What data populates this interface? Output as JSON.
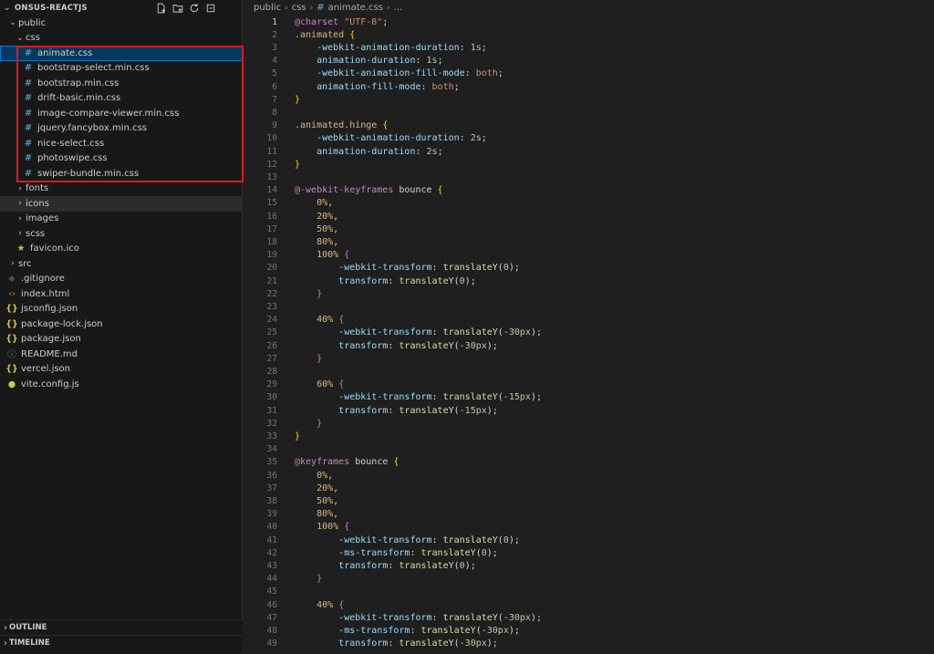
{
  "explorer": {
    "title": "ONSUS-REACTJS",
    "actions": [
      "new-file-icon",
      "new-folder-icon",
      "refresh-icon",
      "collapse-all-icon"
    ],
    "tree": [
      {
        "label": "public",
        "depth": 0,
        "kind": "folder",
        "open": true
      },
      {
        "label": "css",
        "depth": 1,
        "kind": "folder",
        "open": true
      },
      {
        "label": "animate.css",
        "depth": 2,
        "kind": "css",
        "selected": true
      },
      {
        "label": "bootstrap-select.min.css",
        "depth": 2,
        "kind": "css"
      },
      {
        "label": "bootstrap.min.css",
        "depth": 2,
        "kind": "css"
      },
      {
        "label": "drift-basic.min.css",
        "depth": 2,
        "kind": "css"
      },
      {
        "label": "image-compare-viewer.min.css",
        "depth": 2,
        "kind": "css"
      },
      {
        "label": "jquery.fancybox.min.css",
        "depth": 2,
        "kind": "css"
      },
      {
        "label": "nice-select.css",
        "depth": 2,
        "kind": "css"
      },
      {
        "label": "photoswipe.css",
        "depth": 2,
        "kind": "css"
      },
      {
        "label": "swiper-bundle.min.css",
        "depth": 2,
        "kind": "css"
      },
      {
        "label": "fonts",
        "depth": 1,
        "kind": "folder",
        "open": false
      },
      {
        "label": "icons",
        "depth": 1,
        "kind": "folder",
        "open": false,
        "hover": true
      },
      {
        "label": "images",
        "depth": 1,
        "kind": "folder",
        "open": false
      },
      {
        "label": "scss",
        "depth": 1,
        "kind": "folder",
        "open": false
      },
      {
        "label": "favicon.ico",
        "depth": 1,
        "kind": "ico"
      },
      {
        "label": "src",
        "depth": 0,
        "kind": "folder",
        "open": false
      },
      {
        "label": ".gitignore",
        "depth": 0,
        "kind": "git"
      },
      {
        "label": "index.html",
        "depth": 0,
        "kind": "html"
      },
      {
        "label": "jsconfig.json",
        "depth": 0,
        "kind": "json"
      },
      {
        "label": "package-lock.json",
        "depth": 0,
        "kind": "json"
      },
      {
        "label": "package.json",
        "depth": 0,
        "kind": "json"
      },
      {
        "label": "README.md",
        "depth": 0,
        "kind": "md"
      },
      {
        "label": "vercel.json",
        "depth": 0,
        "kind": "json"
      },
      {
        "label": "vite.config.js",
        "depth": 0,
        "kind": "js"
      }
    ],
    "outline_label": "OUTLINE",
    "timeline_label": "TIMELINE"
  },
  "breadcrumb": {
    "parts": [
      "public",
      "css"
    ],
    "file": "animate.css",
    "tail": "..."
  },
  "colors": {
    "accent": "#0078d4",
    "selection": "#04395e",
    "highlight_box": "#e3161e"
  },
  "editor": {
    "current_line": 1,
    "lines": [
      [
        [
          "t-at",
          "@charset "
        ],
        [
          "t-str",
          "\"UTF-8\""
        ],
        [
          "t-plain",
          ";"
        ]
      ],
      [
        [
          "t-sel",
          ".animated "
        ],
        [
          "t-b1",
          "{"
        ]
      ],
      [
        [
          "t-plain",
          "    "
        ],
        [
          "t-prop",
          "-webkit-animation-duration"
        ],
        [
          "t-plain",
          ": "
        ],
        [
          "t-num",
          "1s"
        ],
        [
          "t-plain",
          ";"
        ]
      ],
      [
        [
          "t-plain",
          "    "
        ],
        [
          "t-prop",
          "animation-duration"
        ],
        [
          "t-plain",
          ": "
        ],
        [
          "t-num",
          "1s"
        ],
        [
          "t-plain",
          ";"
        ]
      ],
      [
        [
          "t-plain",
          "    "
        ],
        [
          "t-prop",
          "-webkit-animation-fill-mode"
        ],
        [
          "t-plain",
          ": "
        ],
        [
          "t-val",
          "both"
        ],
        [
          "t-plain",
          ";"
        ]
      ],
      [
        [
          "t-plain",
          "    "
        ],
        [
          "t-prop",
          "animation-fill-mode"
        ],
        [
          "t-plain",
          ": "
        ],
        [
          "t-val",
          "both"
        ],
        [
          "t-plain",
          ";"
        ]
      ],
      [
        [
          "t-b1",
          "}"
        ]
      ],
      [],
      [
        [
          "t-sel",
          ".animated.hinge "
        ],
        [
          "t-b1",
          "{"
        ]
      ],
      [
        [
          "t-plain",
          "    "
        ],
        [
          "t-prop",
          "-webkit-animation-duration"
        ],
        [
          "t-plain",
          ": "
        ],
        [
          "t-num",
          "2s"
        ],
        [
          "t-plain",
          ";"
        ]
      ],
      [
        [
          "t-plain",
          "    "
        ],
        [
          "t-prop",
          "animation-duration"
        ],
        [
          "t-plain",
          ": "
        ],
        [
          "t-num",
          "2s"
        ],
        [
          "t-plain",
          ";"
        ]
      ],
      [
        [
          "t-b1",
          "}"
        ]
      ],
      [],
      [
        [
          "t-at",
          "@-webkit-keyframes "
        ],
        [
          "t-plain",
          "bounce "
        ],
        [
          "t-b1",
          "{"
        ]
      ],
      [
        [
          "t-plain",
          "    "
        ],
        [
          "t-kf",
          "0%"
        ],
        [
          "t-plain",
          ","
        ]
      ],
      [
        [
          "t-plain",
          "    "
        ],
        [
          "t-kf",
          "20%"
        ],
        [
          "t-plain",
          ","
        ]
      ],
      [
        [
          "t-plain",
          "    "
        ],
        [
          "t-kf",
          "50%"
        ],
        [
          "t-plain",
          ","
        ]
      ],
      [
        [
          "t-plain",
          "    "
        ],
        [
          "t-kf",
          "80%"
        ],
        [
          "t-plain",
          ","
        ]
      ],
      [
        [
          "t-plain",
          "    "
        ],
        [
          "t-kf",
          "100% "
        ],
        [
          "t-b2",
          "{"
        ]
      ],
      [
        [
          "t-plain",
          "        "
        ],
        [
          "t-prop",
          "-webkit-transform"
        ],
        [
          "t-plain",
          ": "
        ],
        [
          "t-fn",
          "translateY"
        ],
        [
          "t-plain",
          "("
        ],
        [
          "t-num",
          "0"
        ],
        [
          "t-plain",
          ");"
        ]
      ],
      [
        [
          "t-plain",
          "        "
        ],
        [
          "t-prop",
          "transform"
        ],
        [
          "t-plain",
          ": "
        ],
        [
          "t-fn",
          "translateY"
        ],
        [
          "t-plain",
          "("
        ],
        [
          "t-num",
          "0"
        ],
        [
          "t-plain",
          ");"
        ]
      ],
      [
        [
          "t-plain",
          "    "
        ],
        [
          "t-b2",
          "}"
        ]
      ],
      [],
      [
        [
          "t-plain",
          "    "
        ],
        [
          "t-kf",
          "40% "
        ],
        [
          "t-b2",
          "{"
        ]
      ],
      [
        [
          "t-plain",
          "        "
        ],
        [
          "t-prop",
          "-webkit-transform"
        ],
        [
          "t-plain",
          ": "
        ],
        [
          "t-fn",
          "translateY"
        ],
        [
          "t-plain",
          "("
        ],
        [
          "t-num",
          "-30px"
        ],
        [
          "t-plain",
          ");"
        ]
      ],
      [
        [
          "t-plain",
          "        "
        ],
        [
          "t-prop",
          "transform"
        ],
        [
          "t-plain",
          ": "
        ],
        [
          "t-fn",
          "translateY"
        ],
        [
          "t-plain",
          "("
        ],
        [
          "t-num",
          "-30px"
        ],
        [
          "t-plain",
          ");"
        ]
      ],
      [
        [
          "t-plain",
          "    "
        ],
        [
          "t-b2",
          "}"
        ]
      ],
      [],
      [
        [
          "t-plain",
          "    "
        ],
        [
          "t-kf",
          "60% "
        ],
        [
          "t-b2",
          "{"
        ]
      ],
      [
        [
          "t-plain",
          "        "
        ],
        [
          "t-prop",
          "-webkit-transform"
        ],
        [
          "t-plain",
          ": "
        ],
        [
          "t-fn",
          "translateY"
        ],
        [
          "t-plain",
          "("
        ],
        [
          "t-num",
          "-15px"
        ],
        [
          "t-plain",
          ");"
        ]
      ],
      [
        [
          "t-plain",
          "        "
        ],
        [
          "t-prop",
          "transform"
        ],
        [
          "t-plain",
          ": "
        ],
        [
          "t-fn",
          "translateY"
        ],
        [
          "t-plain",
          "("
        ],
        [
          "t-num",
          "-15px"
        ],
        [
          "t-plain",
          ");"
        ]
      ],
      [
        [
          "t-plain",
          "    "
        ],
        [
          "t-b2",
          "}"
        ]
      ],
      [
        [
          "t-b1",
          "}"
        ]
      ],
      [],
      [
        [
          "t-at",
          "@keyframes "
        ],
        [
          "t-plain",
          "bounce "
        ],
        [
          "t-b1",
          "{"
        ]
      ],
      [
        [
          "t-plain",
          "    "
        ],
        [
          "t-kf",
          "0%"
        ],
        [
          "t-plain",
          ","
        ]
      ],
      [
        [
          "t-plain",
          "    "
        ],
        [
          "t-kf",
          "20%"
        ],
        [
          "t-plain",
          ","
        ]
      ],
      [
        [
          "t-plain",
          "    "
        ],
        [
          "t-kf",
          "50%"
        ],
        [
          "t-plain",
          ","
        ]
      ],
      [
        [
          "t-plain",
          "    "
        ],
        [
          "t-kf",
          "80%"
        ],
        [
          "t-plain",
          ","
        ]
      ],
      [
        [
          "t-plain",
          "    "
        ],
        [
          "t-kf",
          "100% "
        ],
        [
          "t-b2",
          "{"
        ]
      ],
      [
        [
          "t-plain",
          "        "
        ],
        [
          "t-prop",
          "-webkit-transform"
        ],
        [
          "t-plain",
          ": "
        ],
        [
          "t-fn",
          "translateY"
        ],
        [
          "t-plain",
          "("
        ],
        [
          "t-num",
          "0"
        ],
        [
          "t-plain",
          ");"
        ]
      ],
      [
        [
          "t-plain",
          "        "
        ],
        [
          "t-prop",
          "-ms-transform"
        ],
        [
          "t-plain",
          ": "
        ],
        [
          "t-fn",
          "translateY"
        ],
        [
          "t-plain",
          "("
        ],
        [
          "t-num",
          "0"
        ],
        [
          "t-plain",
          ");"
        ]
      ],
      [
        [
          "t-plain",
          "        "
        ],
        [
          "t-prop",
          "transform"
        ],
        [
          "t-plain",
          ": "
        ],
        [
          "t-fn",
          "translateY"
        ],
        [
          "t-plain",
          "("
        ],
        [
          "t-num",
          "0"
        ],
        [
          "t-plain",
          ");"
        ]
      ],
      [
        [
          "t-plain",
          "    "
        ],
        [
          "t-b2",
          "}"
        ]
      ],
      [],
      [
        [
          "t-plain",
          "    "
        ],
        [
          "t-kf",
          "40% "
        ],
        [
          "t-b2",
          "{"
        ]
      ],
      [
        [
          "t-plain",
          "        "
        ],
        [
          "t-prop",
          "-webkit-transform"
        ],
        [
          "t-plain",
          ": "
        ],
        [
          "t-fn",
          "translateY"
        ],
        [
          "t-plain",
          "("
        ],
        [
          "t-num",
          "-30px"
        ],
        [
          "t-plain",
          ");"
        ]
      ],
      [
        [
          "t-plain",
          "        "
        ],
        [
          "t-prop",
          "-ms-transform"
        ],
        [
          "t-plain",
          ": "
        ],
        [
          "t-fn",
          "translateY"
        ],
        [
          "t-plain",
          "("
        ],
        [
          "t-num",
          "-30px"
        ],
        [
          "t-plain",
          ");"
        ]
      ],
      [
        [
          "t-plain",
          "        "
        ],
        [
          "t-prop",
          "transform"
        ],
        [
          "t-plain",
          ": "
        ],
        [
          "t-fn",
          "translateY"
        ],
        [
          "t-plain",
          "("
        ],
        [
          "t-num",
          "-30px"
        ],
        [
          "t-plain",
          ");"
        ]
      ]
    ]
  }
}
